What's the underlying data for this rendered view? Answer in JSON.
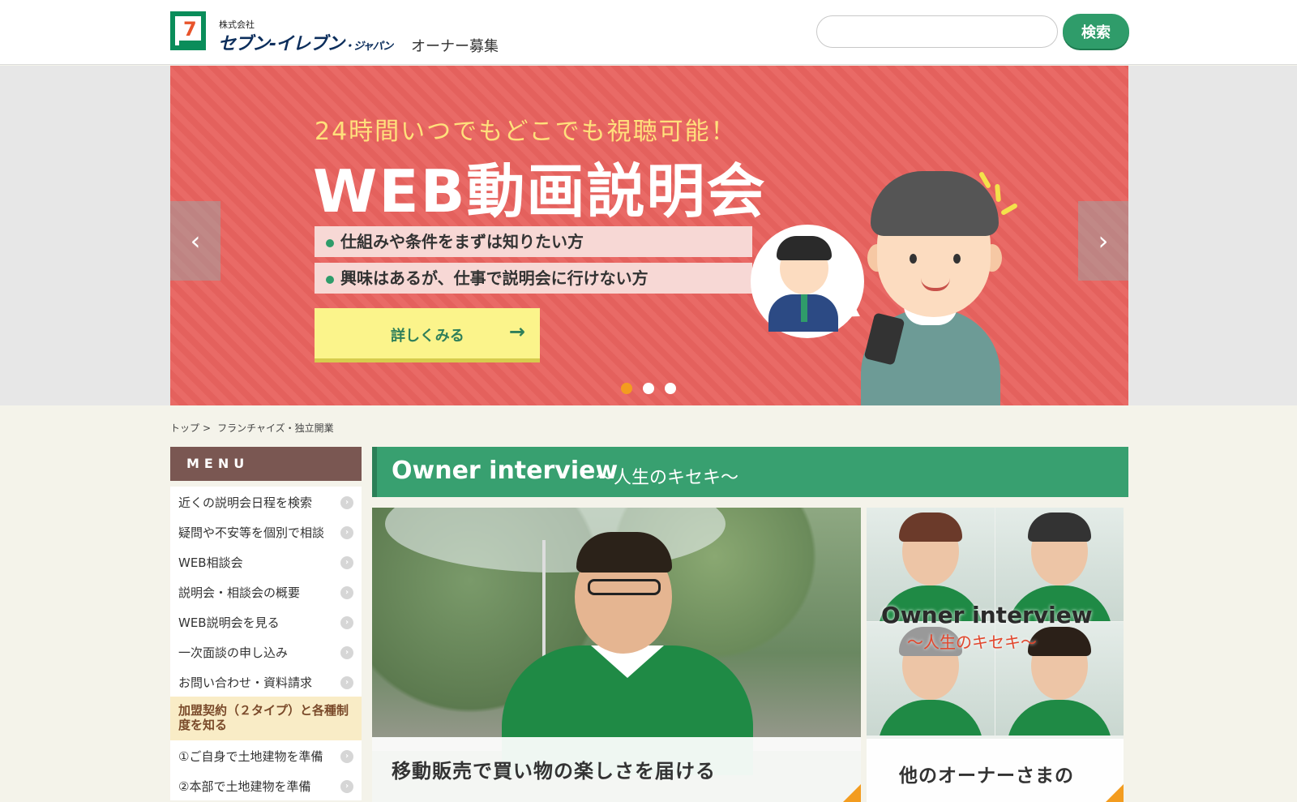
{
  "header": {
    "logo_company_prefix": "株式会社",
    "logo_company_name": "セブン-イレブン",
    "logo_company_suffix": "・ジャパン",
    "logo_subtitle": "オーナー募集",
    "search_placeholder": "",
    "search_button": "検索"
  },
  "hero": {
    "tagline": "24時間いつでもどこでも視聴可能！",
    "title": "WEB動画説明会",
    "points": [
      "仕組みや条件をまずは知りたい方",
      "興味はあるが、仕事で説明会に行けない方"
    ],
    "cta_label": "詳しくみる",
    "prev_arrow": "‹",
    "next_arrow": "›",
    "slide_count": 3,
    "active_slide": 1
  },
  "breadcrumb": {
    "home": "トップ",
    "separator": ">",
    "current": "フランチャイズ・独立開業"
  },
  "sidebar": {
    "heading": "MENU",
    "items": [
      "近くの説明会日程を検索",
      "疑問や不安等を個別で相談",
      "WEB相談会",
      "説明会・相談会の概要",
      "WEB説明会を見る",
      "一次面談の申し込み",
      "お問い合わせ・資料請求"
    ],
    "highlight": "加盟契約（２タイプ）と各種制度を知る",
    "sub_items": [
      "①ご自身で土地建物を準備",
      "②本部で土地建物を準備"
    ]
  },
  "main": {
    "section_title": "Owner interview",
    "section_subtitle": "～人生のキセキ～",
    "feature_caption": "移動販売で買い物の楽しさを届ける",
    "side_title": "Owner interview",
    "side_subtitle": "～人生のキセキ～",
    "side_caption": "他のオーナーさまの"
  },
  "colors": {
    "brand_green": "#38a070",
    "hero_red": "#e96a66",
    "menu_brown": "#7a5752",
    "accent_orange": "#f39c1f"
  }
}
